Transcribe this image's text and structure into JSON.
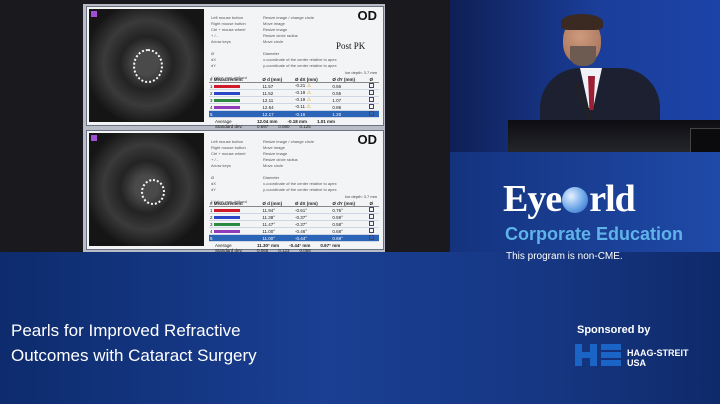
{
  "slide": {
    "top_panel": {
      "eye_label": "OD",
      "note": "Post PK",
      "rows": [
        {
          "d": "11.57",
          "dx": "-0.21",
          "dy": "0.56",
          "color": "#d11b2a",
          "warn": true
        },
        {
          "d": "11.52",
          "dx": "-0.19",
          "dy": "0.55",
          "color": "#2b46c8",
          "warn": true
        },
        {
          "d": "12.11",
          "dx": "-0.19",
          "dy": "1.07",
          "color": "#2b8a3f",
          "warn": true
        },
        {
          "d": "12.64",
          "dx": "-0.11",
          "dy": "0.86",
          "color": "#8f3ab8",
          "warn": true
        },
        {
          "d": "12.17",
          "dx": "-0.16",
          "dy": "1.20",
          "color": "#2c64b8",
          "warn": false
        }
      ],
      "average_label": "Average",
      "average": [
        "12.04 mm",
        "-0.18 mm",
        "1.01 mm"
      ],
      "stddev_label": "Standard dev.",
      "stddev": [
        "0.697",
        "0.080",
        "0.125"
      ]
    },
    "bottom_panel": {
      "eye_label": "OD",
      "rows": [
        {
          "d": "11.94°",
          "dx": "-0.61°",
          "dy": "0.76°",
          "color": "#d11b2a"
        },
        {
          "d": "11.38°",
          "dx": "-0.37°",
          "dy": "0.59°",
          "color": "#2b46c8"
        },
        {
          "d": "11.47°",
          "dx": "-0.37°",
          "dy": "0.58°",
          "color": "#2b8a3f"
        },
        {
          "d": "11.00°",
          "dx": "-0.46°",
          "dy": "0.68°",
          "color": "#8f3ab8"
        },
        {
          "d": "11.00°",
          "dx": "-0.44°",
          "dy": "0.69°",
          "color": "#2c64b8"
        }
      ],
      "average_label": "Average",
      "average": [
        "11.30° mm",
        "-0.44° mm",
        "0.67° mm"
      ],
      "stddev_label": "Standard dev.",
      "stddev": [
        "0.065",
        "0.123",
        "0.058"
      ]
    },
    "columns": [
      "# Measurement",
      "Ø d (mm)",
      "Ø dX (mm)",
      "Ø dY (mm)",
      "Ø"
    ],
    "key_lines": [
      "Left mouse button",
      "Right mouse button",
      "Ctrl + mouse wheel",
      "+ / -",
      "Arrow keys"
    ],
    "val_lines": [
      "Resize image / change circle",
      "Move image",
      "Resize image",
      "Resize circle radius",
      "Move circle"
    ],
    "legend_lines": [
      "Ø",
      "dX",
      "dY"
    ],
    "legend_vals": [
      "Diameter",
      "x-coordinate of the center relative to apex",
      "y-coordinate of the center relative to apex"
    ],
    "values_note": "* Value user-defined",
    "depth_label": "Ice depth: 3.7 mm"
  },
  "branding": {
    "logo_left": "Eye",
    "logo_right": "rld",
    "subtitle": "Corporate Education",
    "cme_note": "This program is non-CME."
  },
  "course": {
    "title_line1": "Pearls for Improved Refractive",
    "title_line2": "Outcomes with Cataract Surgery"
  },
  "sponsor": {
    "label": "Sponsored by",
    "company_line1": "HAAG-STREIT",
    "company_line2": "USA"
  },
  "colors": {
    "accent": "#5fb3ea",
    "banner": "#1a3f93",
    "brand_blue": "#1a64c6"
  }
}
